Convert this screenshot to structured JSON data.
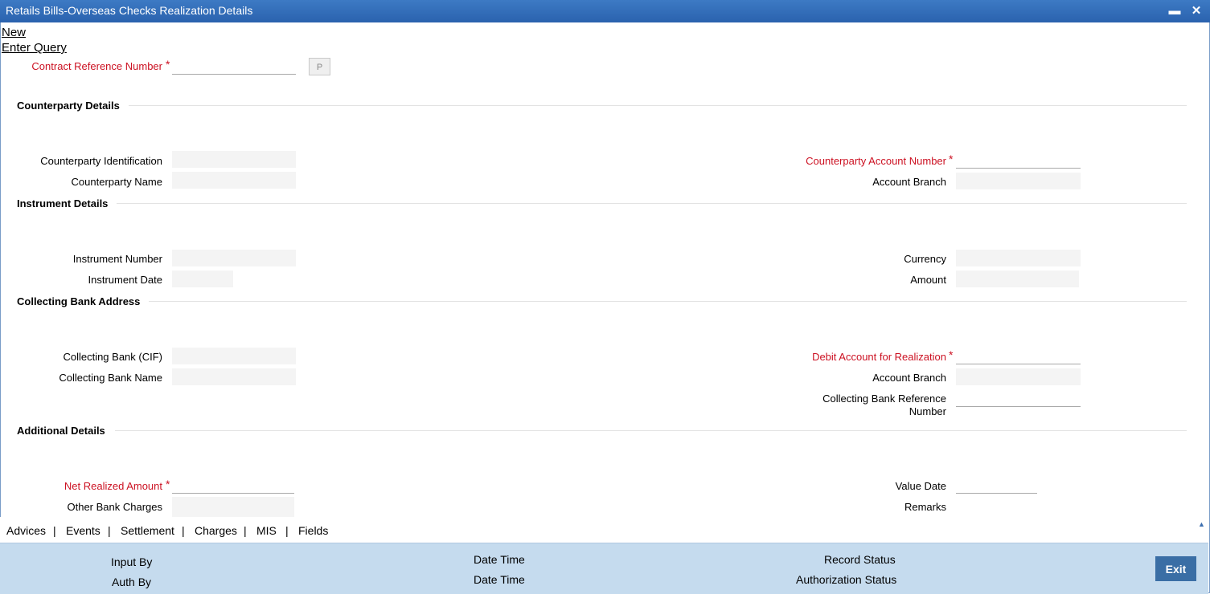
{
  "window": {
    "title": "Retails Bills-Overseas Checks Realization Details",
    "minimize": "▬",
    "close": "✕"
  },
  "menu": {
    "new": "New",
    "enter_query": "Enter Query"
  },
  "header": {
    "contract_ref_label": "Contract Reference Number",
    "contract_ref_value": "",
    "p_button": "P"
  },
  "sections": {
    "counterparty": "Counterparty Details",
    "instrument": "Instrument Details",
    "collecting": "Collecting Bank Address",
    "additional": "Additional Details"
  },
  "fields": {
    "cp_identification": "Counterparty Identification",
    "cp_name": "Counterparty Name",
    "cp_account_number": "Counterparty Account Number",
    "cp_account_branch": "Account Branch",
    "instrument_number": "Instrument Number",
    "instrument_date": "Instrument Date",
    "currency": "Currency",
    "amount": "Amount",
    "collecting_bank_cif": "Collecting Bank (CIF)",
    "collecting_bank_name": "Collecting Bank Name",
    "debit_account": "Debit Account for Realization",
    "debit_account_branch": "Account Branch",
    "collecting_bank_ref_1": "Collecting Bank Reference",
    "collecting_bank_ref_2": "Number",
    "net_realized_amount": "Net Realized Amount",
    "other_bank_charges": "Other Bank Charges",
    "value_date": "Value Date",
    "remarks": "Remarks"
  },
  "required_mark": "*",
  "tabs": [
    "Advices",
    "Events",
    "Settlement",
    "Charges",
    "MIS",
    "Fields"
  ],
  "tab_separator": "|",
  "footer": {
    "input_by": "Input By",
    "auth_by": "Auth By",
    "date_time_1": "Date Time",
    "date_time_2": "Date Time",
    "record_status": "Record Status",
    "authorization_status": "Authorization Status",
    "exit": "Exit"
  },
  "colors": {
    "title_bar": "#2f6bb5",
    "required": "#cc1122",
    "footer": "#c5dbee",
    "exit_button": "#3a6ea5"
  }
}
